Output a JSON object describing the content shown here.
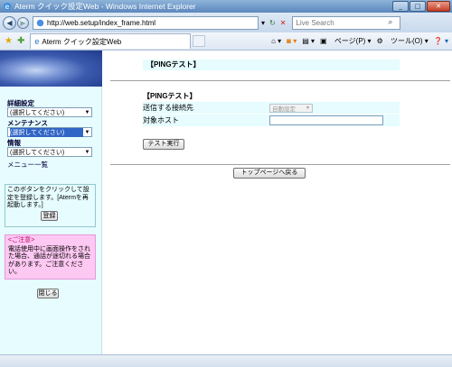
{
  "window": {
    "title": "Aterm クイック設定Web - Windows Internet Explorer"
  },
  "address_bar": {
    "url": "http://web.setup/index_frame.html",
    "search_placeholder": "Live Search"
  },
  "tabs": [
    {
      "label": "Aterm クイック設定Web"
    }
  ],
  "commands": {
    "page": "ページ(P)",
    "tools": "ツール(O)"
  },
  "sidebar": {
    "groups": [
      {
        "label": "詳細設定",
        "selected": "(選択してください)"
      },
      {
        "label": "メンテナンス",
        "selected": "(選択してください)"
      },
      {
        "label": "情報",
        "selected": "(選択してください)"
      }
    ],
    "menu_list_link": "メニュー一覧",
    "info_text": "このボタンをクリックして設定を登録します。[Atermを再起動します。]",
    "register_button": "登録",
    "warning_title": "<ご注意>",
    "warning_text": "電話使用中に画面操作をされた場合、通話が途切れる場合があります。ご注意ください。",
    "close_button": "閉じる"
  },
  "main": {
    "header": "【PINGテスト】",
    "section_title": "【PINGテスト】",
    "fields": [
      {
        "label": "送信する接続先",
        "value": "自動設定"
      },
      {
        "label": "対象ホスト",
        "value": ""
      }
    ],
    "test_button": "テスト実行",
    "top_button": "トップページへ戻る"
  }
}
